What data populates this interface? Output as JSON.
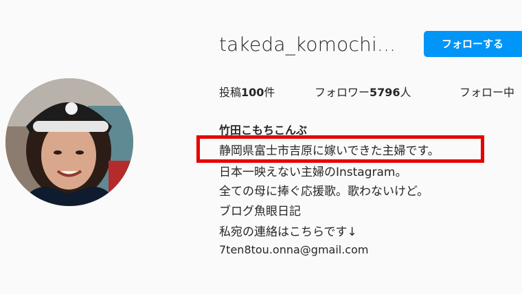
{
  "profile": {
    "username": "takeda_komochi...",
    "follow_button_label": "フォローする",
    "avatar_label": "avatar"
  },
  "stats": {
    "posts_prefix": "投稿",
    "posts_count": "100",
    "posts_suffix": "件",
    "followers_prefix": "フォロワー",
    "followers_count": "5796",
    "followers_suffix": "人",
    "following_label": "フォロー中"
  },
  "bio": {
    "display_name": "竹田こもちこんぶ",
    "lines": [
      "静岡県富士市吉原に嫁いできた主婦です。",
      "日本一映えない主婦のInstagram。",
      "全ての母に捧ぐ応援歌。歌わないけど。",
      "ブログ魚眼日記",
      "私宛の連絡はこちらです↓"
    ],
    "email": "7ten8tou.onna@gmail.com"
  },
  "colors": {
    "background": "#fafafa",
    "follow_button": "#0095f6",
    "highlight": "#e60000",
    "text": "#262626"
  }
}
